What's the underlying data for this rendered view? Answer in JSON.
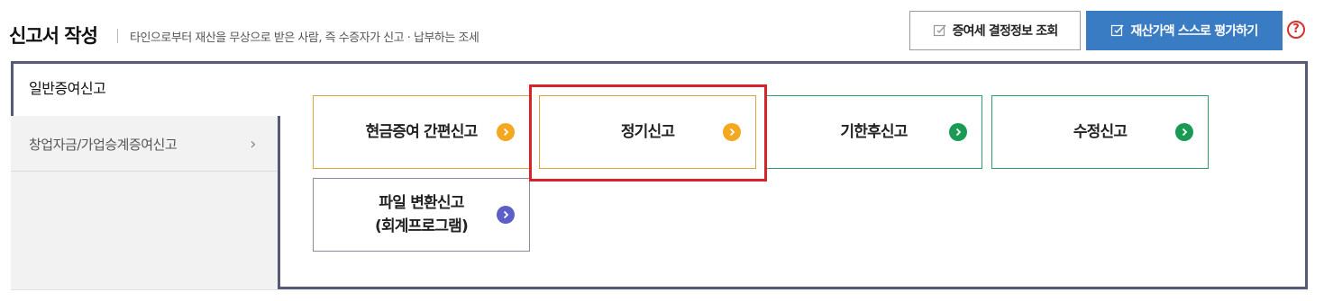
{
  "header": {
    "title": "신고서 작성",
    "subtitle": "타인으로부터 재산을 무상으로 받은 사람, 즉 수증자가 신고 · 납부하는 조세",
    "inquiry_button": "증여세 결정정보 조회",
    "evaluate_button": "재산가액 스스로 평가하기",
    "help_symbol": "?"
  },
  "tabs": {
    "active": "일반증여신고",
    "items": [
      {
        "label": "창업자금/가업승계증여신고",
        "chevron": "›"
      }
    ]
  },
  "cards": [
    {
      "label": "현금증여 간편신고",
      "color": "orange"
    },
    {
      "label": "정기신고",
      "color": "orange",
      "highlighted": true
    },
    {
      "label": "기한후신고",
      "color": "green"
    },
    {
      "label": "수정신고",
      "color": "green"
    },
    {
      "label_line1": "파일 변환신고",
      "label_line2": "(회계프로그램)",
      "color": "purple"
    }
  ],
  "colors": {
    "accent_blue": "#3a7cc4",
    "frame": "#555b77",
    "orange": "#f3a81f",
    "green": "#1b9a55",
    "purple": "#5b5fc7",
    "highlight_red": "#d8232a"
  }
}
